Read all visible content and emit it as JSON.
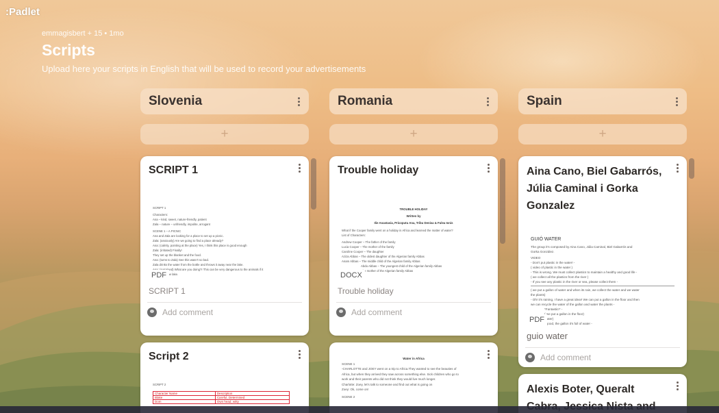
{
  "app": {
    "logo": ":Padlet"
  },
  "board": {
    "meta": "emmagisbert + 15 • 1mo",
    "title": "Scripts",
    "subtitle": "Upload here your scripts in English that will be used to record your advertisements"
  },
  "columns": [
    {
      "title": "Slovenia",
      "add_label": "+",
      "cards": [
        {
          "title": "SCRIPT 1",
          "badge": "PDF",
          "file_label": "SCRIPT 1",
          "comment": "Add comment",
          "doc": [
            "SCRIPT 1",
            "Characters:",
            "Ana – kind, sweet, nature-friendly, patient",
            "Zala – nature – unfriendly, impolite, arrogant",
            "SCENE 1 – A PICNIC",
            "Ana and Zala are looking for a place to set up a picnic.",
            "Zala: (anxiously) Are we going to find a place already?",
            "Ana: (calmly, pointing at the place) Yes, I think this place is good enough",
            "Zala: (irritated) Finally!",
            "They set up the blanket and the food.",
            "Ana: (turns to Zala) See this wasn't so bad.",
            "Zala drinks the water from the bottle and throws it away near the lake.",
            "Ana: (surprised) What are you doing?! This can be very dangerous to the animals if it",
            "ends up in the lake."
          ]
        },
        {
          "title": "Script 2",
          "doc_title": "SCRIPT 2",
          "table_header": [
            "Character Name",
            "Description"
          ],
          "table_rows": [
            [
              "Blake",
              "Careful, Determined"
            ],
            [
              "Dom",
              "Own head, witty"
            ]
          ]
        }
      ]
    },
    {
      "title": "Romania",
      "add_label": "+",
      "cards": [
        {
          "title": "Trouble holiday",
          "badge": "DOCX",
          "file_label": "Trouble holiday",
          "comment": "Add comment",
          "doc_header": "TROUBLE HOLIDAY",
          "doc_written": "Written by",
          "doc_authors": "Ilie Anastasia, Pricoputu Ana, Tribu Denisa & Fulea Ionis",
          "doc": [
            "What if the Cooper family went on a holiday in Africa and learned the matter of water?",
            "List of Characters:",
            "Andrew Cooper – The father of the family",
            "Lucia Cooper – The mother of the family",
            "Caroline Cooper – The daughter",
            "Aziza Abbas – The oldest daughter of the Algerian family Abbas",
            "Anam Abbas – The middle child of the Algerian family Abbas",
            "Abdu Abbas – The youngest child of the Algerian family Abbas",
            "The mother of the Algerian family Abbas"
          ]
        },
        {
          "doc_title": "Water in Africa",
          "doc": [
            "SCENE 1",
            "-CHARLOTTE and JOEY went on a trip to Africa.They wanted to see the beauties of",
            "Africa, but when they arrived they saw across something else. Sick children who go to",
            "work and their parents who did not think they would live much longer.",
            "Charlotte: Zoey, let's talk to someone and find out what is going on",
            "Zoey: Ok, come on!",
            "SCENE 2"
          ]
        }
      ]
    },
    {
      "title": "Spain",
      "add_label": "+",
      "cards": [
        {
          "title": "Aina Cano, Biel Gabarrós, Júlia Caminal i Gorka Gonzalez",
          "badge": "PDF",
          "file_label": "guio water",
          "comment": "Add comment",
          "doc_title": "GUIÓ WATER",
          "doc": [
            "The group it's composed by Aina Cano, Júlia Caminal, Biel Gabarrós and",
            "Gorka González.",
            "VIDEO",
            "- Don't put plastic in the water! -",
            "( video of plastic in the water )",
            "- This is wrong. We must collect plastics to maintain a healthy and good life -",
            "( we collect all the plastics from the river )",
            "- If you see any plastic in the river or sea, please collect them -",
            "( we put a gallon of water and when its rain, we collect the water and we water",
            "the plants)",
            "- Oh! it's raining, I have a great idea!! We can put a gallon in the floor and then",
            "we can recycle the water of the gallon and water the plants -",
            "*Fantastic!* -",
            "( we put a gallon in the floor)",
            "( later)",
            "- good, the gallon it's full of water -"
          ]
        },
        {
          "title": "Alexis Boter, Queralt Cabra, Jessica Nista and Ismail El"
        }
      ]
    }
  ],
  "colors": {
    "background": "#eebd86",
    "card": "#ffffff",
    "column_header": "#f6dec4",
    "title_text": "#ffffff"
  }
}
